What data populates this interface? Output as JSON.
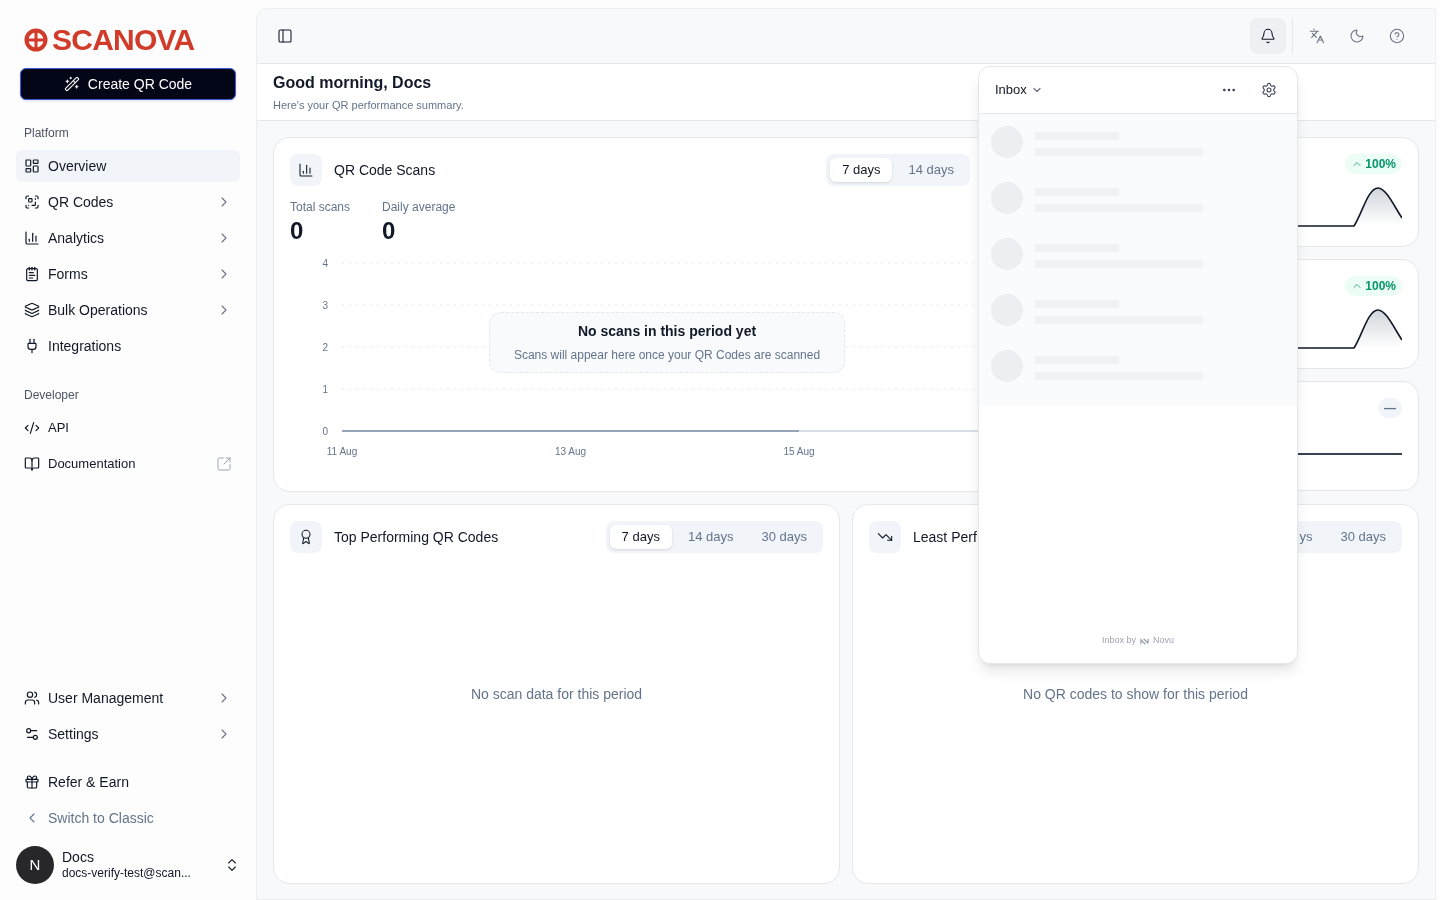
{
  "brand": {
    "name": "SCANOVA"
  },
  "create_button": {
    "label": "Create QR Code"
  },
  "sidebar": {
    "sections": [
      {
        "title": "Platform",
        "items": [
          {
            "label": "Overview",
            "selected": true,
            "expandable": false
          },
          {
            "label": "QR Codes",
            "selected": false,
            "expandable": true
          },
          {
            "label": "Analytics",
            "selected": false,
            "expandable": true
          },
          {
            "label": "Forms",
            "selected": false,
            "expandable": true
          },
          {
            "label": "Bulk Operations",
            "selected": false,
            "expandable": true
          },
          {
            "label": "Integrations",
            "selected": false,
            "expandable": false
          }
        ]
      },
      {
        "title": "Developer",
        "items": [
          {
            "label": "API",
            "selected": false,
            "external": false
          },
          {
            "label": "Documentation",
            "selected": false,
            "external": true
          }
        ]
      }
    ],
    "bottom_items": [
      {
        "label": "User Management",
        "expandable": true
      },
      {
        "label": "Settings",
        "expandable": true
      }
    ],
    "refer": {
      "label": "Refer & Earn"
    },
    "switch": {
      "label": "Switch to Classic"
    },
    "user": {
      "initial": "N",
      "name": "Docs",
      "email": "docs-verify-test@scan..."
    }
  },
  "toolbar": [
    {
      "selected": true
    },
    {
      "selected": false
    },
    {
      "selected": false
    },
    {
      "selected": false
    }
  ],
  "greeting": {
    "title": "Good morning, Docs",
    "subtitle": "Here's your QR performance summary."
  },
  "scans_card": {
    "title": "QR Code Scans",
    "tabs": [
      {
        "label": "7 days",
        "selected": true
      },
      {
        "label": "14 days",
        "selected": false
      }
    ],
    "stats": [
      {
        "label": "Total scans",
        "value": "0"
      },
      {
        "label": "Daily average",
        "value": "0"
      }
    ],
    "chart_data": {
      "type": "line",
      "x": [
        "11 Aug",
        "13 Aug",
        "15 Aug"
      ],
      "series": [
        {
          "color": "#94a3b8",
          "values": [
            0,
            0,
            0
          ]
        }
      ],
      "ylim": [
        0,
        4
      ],
      "yticks": [
        0,
        1,
        2,
        3,
        4
      ],
      "grid": true
    },
    "empty": {
      "title": "No scans in this period yet",
      "text": "Scans will appear here once your QR Codes are scanned"
    }
  },
  "side_cards": [
    {
      "badge": "100%",
      "kind": "up"
    },
    {
      "badge": "100%",
      "kind": "up"
    },
    {
      "badge": "—",
      "kind": "flat"
    }
  ],
  "bottom_cards": [
    {
      "title": "Top Performing QR Codes",
      "tabs": [
        {
          "label": "7 days",
          "selected": true
        },
        {
          "label": "14 days",
          "selected": false
        },
        {
          "label": "30 days",
          "selected": false
        }
      ],
      "empty": "No scan data for this period"
    },
    {
      "title": "Least Perf",
      "tabs": [
        {
          "label": "ys",
          "selected": false
        },
        {
          "label": "30 days",
          "selected": false
        }
      ],
      "empty": "No QR codes to show for this period"
    }
  ],
  "inbox": {
    "title": "Inbox",
    "skeletons": [
      {
        "kind": "skeleton"
      },
      {
        "kind": "skeleton"
      },
      {
        "kind": "skeleton"
      },
      {
        "kind": "skeleton"
      },
      {
        "kind": "skeleton"
      }
    ],
    "footer_prefix": "Inbox by",
    "footer_brand": "Novu"
  }
}
